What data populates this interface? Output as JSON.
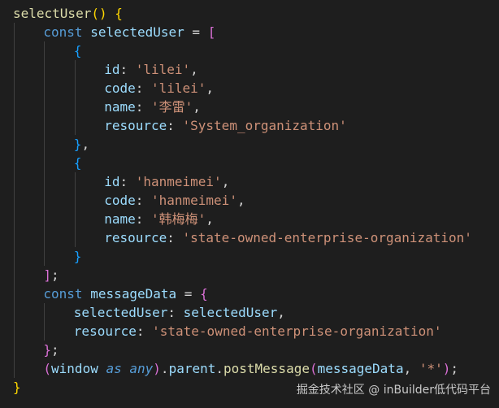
{
  "editor": {
    "theme_background": "#1e1e1e",
    "colors": {
      "keyword": "#569cd6",
      "function": "#dcdcaa",
      "variable": "#9cdcfe",
      "string": "#ce9178",
      "bracket_level1": "#ffd700",
      "bracket_level2": "#da70d6",
      "bracket_level3": "#179fff"
    },
    "lines": [
      {
        "indent": 0,
        "tokens": [
          [
            "fn",
            "selectUser"
          ],
          [
            "b1",
            "()"
          ],
          [
            "punc",
            " "
          ],
          [
            "b1",
            "{"
          ]
        ]
      },
      {
        "indent": 1,
        "tokens": [
          [
            "kw",
            "const"
          ],
          [
            "punc",
            " "
          ],
          [
            "var",
            "selectedUser"
          ],
          [
            "punc",
            " = "
          ],
          [
            "b2",
            "["
          ]
        ]
      },
      {
        "indent": 2,
        "tokens": [
          [
            "b3",
            "{"
          ]
        ]
      },
      {
        "indent": 3,
        "tokens": [
          [
            "var",
            "id"
          ],
          [
            "punc",
            ": "
          ],
          [
            "str",
            "'lilei'"
          ],
          [
            "punc",
            ","
          ]
        ]
      },
      {
        "indent": 3,
        "tokens": [
          [
            "var",
            "code"
          ],
          [
            "punc",
            ": "
          ],
          [
            "str",
            "'lilei'"
          ],
          [
            "punc",
            ","
          ]
        ]
      },
      {
        "indent": 3,
        "tokens": [
          [
            "var",
            "name"
          ],
          [
            "punc",
            ": "
          ],
          [
            "str",
            "'李雷'"
          ],
          [
            "punc",
            ","
          ]
        ]
      },
      {
        "indent": 3,
        "tokens": [
          [
            "var",
            "resource"
          ],
          [
            "punc",
            ": "
          ],
          [
            "str",
            "'System_organization'"
          ]
        ]
      },
      {
        "indent": 2,
        "tokens": [
          [
            "b3",
            "}"
          ],
          [
            "punc",
            ","
          ]
        ]
      },
      {
        "indent": 2,
        "tokens": [
          [
            "b3",
            "{"
          ]
        ]
      },
      {
        "indent": 3,
        "tokens": [
          [
            "var",
            "id"
          ],
          [
            "punc",
            ": "
          ],
          [
            "str",
            "'hanmeimei'"
          ],
          [
            "punc",
            ","
          ]
        ]
      },
      {
        "indent": 3,
        "tokens": [
          [
            "var",
            "code"
          ],
          [
            "punc",
            ": "
          ],
          [
            "str",
            "'hanmeimei'"
          ],
          [
            "punc",
            ","
          ]
        ]
      },
      {
        "indent": 3,
        "tokens": [
          [
            "var",
            "name"
          ],
          [
            "punc",
            ": "
          ],
          [
            "str",
            "'韩梅梅'"
          ],
          [
            "punc",
            ","
          ]
        ]
      },
      {
        "indent": 3,
        "tokens": [
          [
            "var",
            "resource"
          ],
          [
            "punc",
            ": "
          ],
          [
            "str",
            "'state-owned-enterprise-organization'"
          ]
        ]
      },
      {
        "indent": 2,
        "tokens": [
          [
            "b3",
            "}"
          ]
        ]
      },
      {
        "indent": 1,
        "tokens": [
          [
            "b2",
            "]"
          ],
          [
            "punc",
            ";"
          ]
        ]
      },
      {
        "indent": 1,
        "tokens": [
          [
            "kw",
            "const"
          ],
          [
            "punc",
            " "
          ],
          [
            "var",
            "messageData"
          ],
          [
            "punc",
            " = "
          ],
          [
            "b2",
            "{"
          ]
        ]
      },
      {
        "indent": 2,
        "tokens": [
          [
            "var",
            "selectedUser"
          ],
          [
            "punc",
            ": "
          ],
          [
            "var",
            "selectedUser"
          ],
          [
            "punc",
            ","
          ]
        ]
      },
      {
        "indent": 2,
        "tokens": [
          [
            "var",
            "resource"
          ],
          [
            "punc",
            ": "
          ],
          [
            "str",
            "'state-owned-enterprise-organization'"
          ]
        ]
      },
      {
        "indent": 1,
        "tokens": [
          [
            "b2",
            "}"
          ],
          [
            "punc",
            ";"
          ]
        ]
      },
      {
        "indent": 1,
        "tokens": [
          [
            "b2",
            "("
          ],
          [
            "var",
            "window"
          ],
          [
            "punc",
            " "
          ],
          [
            "kw-it",
            "as"
          ],
          [
            "punc",
            " "
          ],
          [
            "kw-it",
            "any"
          ],
          [
            "b2",
            ")"
          ],
          [
            "punc",
            "."
          ],
          [
            "var",
            "parent"
          ],
          [
            "punc",
            "."
          ],
          [
            "fn",
            "postMessage"
          ],
          [
            "b2",
            "("
          ],
          [
            "var",
            "messageData"
          ],
          [
            "punc",
            ", "
          ],
          [
            "str",
            "'*'"
          ],
          [
            "b2",
            ")"
          ],
          [
            "punc",
            ";"
          ]
        ]
      },
      {
        "indent": 0,
        "tokens": [
          [
            "b1",
            "}"
          ]
        ]
      }
    ]
  },
  "watermark": {
    "text": "掘金技术社区 @ inBuilder低代码平台"
  }
}
